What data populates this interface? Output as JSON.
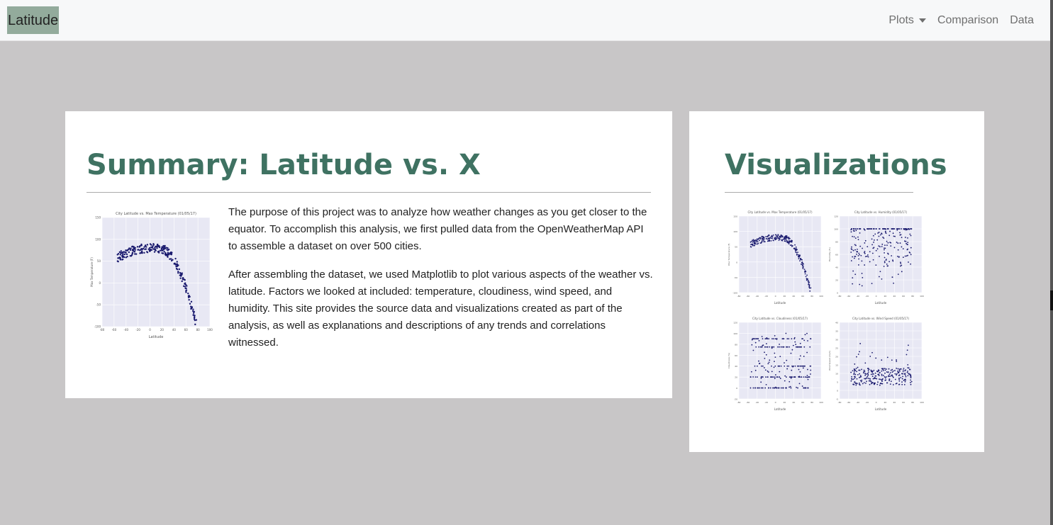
{
  "nav": {
    "brand": "Latitude",
    "items": [
      {
        "label": "Plots",
        "dropdown": true
      },
      {
        "label": "Comparison",
        "dropdown": false
      },
      {
        "label": "Data",
        "dropdown": false
      }
    ]
  },
  "summary": {
    "title": "Summary: Latitude vs. X",
    "paragraphs": [
      "The purpose of this project was to analyze how weather changes as you get closer to the equator. To accomplish this analysis, we first pulled data from the OpenWeatherMap API to assemble a dataset on over 500 cities.",
      "After assembling the dataset, we used Matplotlib to plot various aspects of the weather vs. latitude. Factors we looked at included: temperature, cloudiness, wind speed, and humidity. This site provides the source data and visualizations created as part of the analysis, as well as explanations and descriptions of any trends and correlations witnessed."
    ]
  },
  "visualizations": {
    "title": "Visualizations"
  },
  "colors": {
    "accent": "#3f7262",
    "brand_bg": "#93ab9c",
    "page_bg": "#c8c6c7",
    "point": "#1a1a6e",
    "plot_bg": "#e8e8f4"
  },
  "chart_data": [
    {
      "type": "scatter",
      "title": "City Latitude vs. Max Temperature (01/05/17)",
      "xlabel": "Latitude",
      "ylabel": "Max Temperature (F)",
      "xlim": [
        -80,
        100
      ],
      "ylim": [
        -100,
        150
      ],
      "xticks": [
        "-80",
        "-60",
        "-40",
        "-20",
        "0",
        "20",
        "40",
        "60",
        "80",
        "100"
      ],
      "yticks": [
        "150",
        "100",
        "50",
        "0",
        "-50",
        "-100"
      ],
      "trend": "temp"
    },
    {
      "type": "scatter",
      "title": "City Latitude vs. Humidity (01/05/17)",
      "xlabel": "Latitude",
      "ylabel": "Humidity (%)",
      "xlim": [
        -80,
        100
      ],
      "ylim": [
        0,
        120
      ],
      "xticks": [
        "-80",
        "-60",
        "-40",
        "-20",
        "0",
        "20",
        "40",
        "60",
        "80",
        "100"
      ],
      "yticks": [
        "120",
        "100",
        "80",
        "60",
        "40",
        "20",
        "0"
      ],
      "trend": "humidity"
    },
    {
      "type": "scatter",
      "title": "City Latitude vs. Cloudiness (01/05/17)",
      "xlabel": "Latitude",
      "ylabel": "Cloudiness (%)",
      "xlim": [
        -80,
        100
      ],
      "ylim": [
        -20,
        120
      ],
      "xticks": [
        "-80",
        "-60",
        "-40",
        "-20",
        "0",
        "20",
        "40",
        "60",
        "80",
        "100"
      ],
      "yticks": [
        "120",
        "100",
        "80",
        "60",
        "40",
        "20",
        "0",
        "-20"
      ],
      "trend": "cloud"
    },
    {
      "type": "scatter",
      "title": "City Latitude vs. Wind Speed (01/05/17)",
      "xlabel": "Latitude",
      "ylabel": "Wind Speed (mph)",
      "xlim": [
        -80,
        100
      ],
      "ylim": [
        -5,
        40
      ],
      "xticks": [
        "-80",
        "-60",
        "-40",
        "-20",
        "0",
        "20",
        "40",
        "60",
        "80",
        "100"
      ],
      "yticks": [
        "40",
        "35",
        "30",
        "25",
        "20",
        "15",
        "10",
        "5",
        "0",
        "-5"
      ],
      "trend": "wind"
    }
  ]
}
